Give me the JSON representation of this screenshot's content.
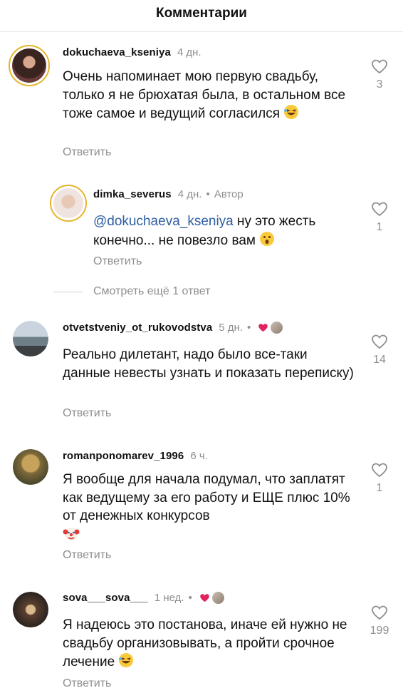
{
  "header": {
    "title": "Комментарии"
  },
  "comments": [
    {
      "username": "dokuchaeva_kseniya",
      "time": "4 дн.",
      "text": "Очень напоминает мою первую свадьбу, только я не брюхатая была, в остальном все тоже самое и ведущий согласился",
      "reply_label": "Ответить",
      "likes": "3"
    },
    {
      "username": "dimka_severus",
      "time": "4 дн.",
      "author_label": "Автор",
      "mention": "@dokuchaeva_kseniya",
      "text": "ну это жесть конечно... не повезло вам",
      "reply_label": "Ответить",
      "likes": "1"
    },
    {
      "username": "otvetstveniy_ot_rukovodstva",
      "time": "5 дн.",
      "text": "Реально дилетант, надо было все-таки данные невесты узнать и показать переписку)",
      "reply_label": "Ответить",
      "likes": "14"
    },
    {
      "username": "romanponomarev_1996",
      "time": "6 ч.",
      "text": "Я вообще для начала подумал, что заплатят как ведущему за его работу и ЕЩЕ плюс 10% от денежных конкурсов",
      "reply_label": "Ответить",
      "likes": "1"
    },
    {
      "username": "sova___sova___",
      "time": "1 нед.",
      "text": "Я надеюсь это постанова,  иначе ей нужно не свадьбу организовывать,  а пройти срочное лечение",
      "reply_label": "Ответить",
      "likes": "199"
    }
  ],
  "more_replies": "Смотреть ещё 1 ответ",
  "colors": {
    "mention": "#2f5fa3",
    "secondary": "#8e8e8e",
    "heart": "#e0245e",
    "story_ring": "#e6b42a"
  }
}
